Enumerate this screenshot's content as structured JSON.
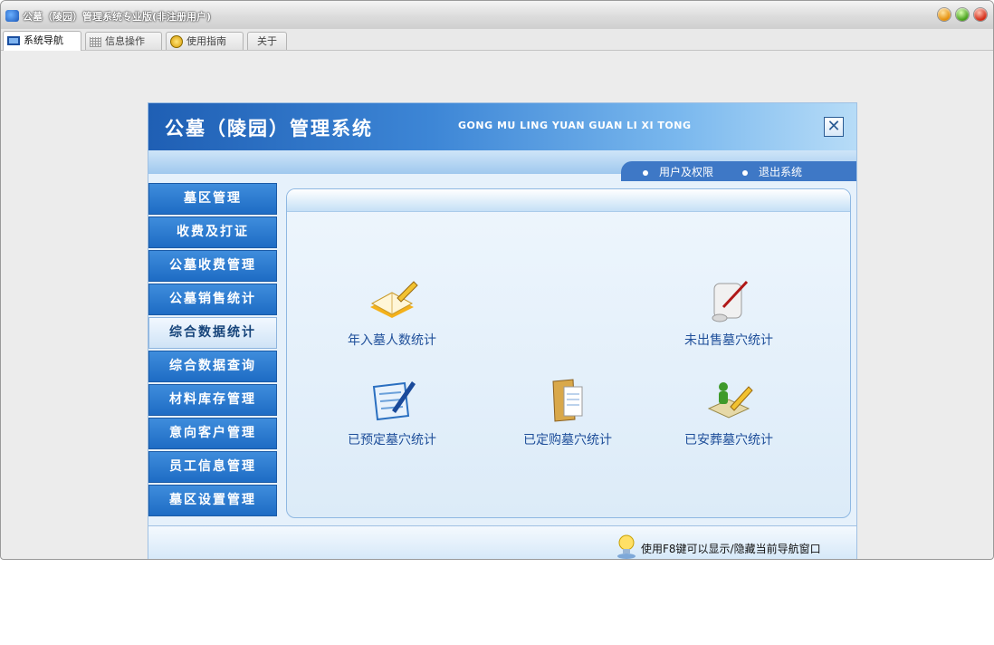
{
  "window": {
    "title": "公墓（陵园）管理系统专业版(非注册用户)"
  },
  "tabs": [
    {
      "label": "系统导航",
      "icon": "monitor-icon"
    },
    {
      "label": "信息操作",
      "icon": "grid-icon"
    },
    {
      "label": "使用指南",
      "icon": "help-icon"
    },
    {
      "label": "关于"
    }
  ],
  "banner": {
    "title": "公墓（陵园）管理系统",
    "subtitle": "GONG MU LING YUAN GUAN LI XI TONG",
    "close": "✕"
  },
  "links": {
    "users": "用户及权限",
    "exit": "退出系统"
  },
  "menu": [
    "墓区管理",
    "收费及打证",
    "公墓收费管理",
    "公墓销售统计",
    "综合数据统计",
    "综合数据查询",
    "材料库存管理",
    "意向客户管理",
    "员工信息管理",
    "墓区设置管理"
  ],
  "tiles": {
    "annual": "年入墓人数统计",
    "unsold": "未出售墓穴统计",
    "reserved": "已预定墓穴统计",
    "purchased": "已定购墓穴统计",
    "buried": "已安葬墓穴统计"
  },
  "footer": {
    "tip": "使用F8键可以显示/隐藏当前导航窗口"
  },
  "colors": {
    "accent": "#1e6cc4",
    "banner": "#1f5fb4",
    "text": "#1f4f9a"
  }
}
